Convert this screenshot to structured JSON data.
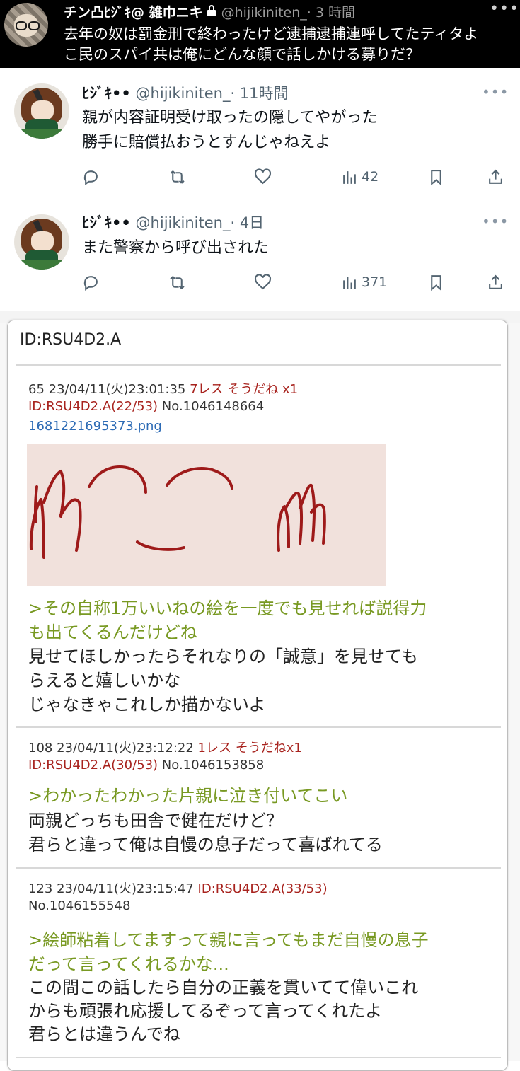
{
  "top_tweet": {
    "name": "チン凸ﾋｼﾞｷ@ 雑巾ニキ",
    "handle": "@hijikiniten_",
    "time": "· 3 時間",
    "more": "•••",
    "line1": "去年の奴は罰金刑で終わったけど逮捕逮捕連呼してたティタよ",
    "line2": "こ民のスパイ共は俺にどんな顔で話しかける募りだ？"
  },
  "tweets": [
    {
      "name": "ﾋｼﾞｷ••",
      "handle": "@hijikiniten_",
      "time": "· 11時間",
      "more": "•••",
      "line1": "親が内容証明受け取ったの隠してやがった",
      "line2": "勝手に賠償払おうとすんじゃねえよ",
      "views": "42"
    },
    {
      "name": "ﾋｼﾞｷ••",
      "handle": "@hijikiniten_",
      "time": "· 4日",
      "more": "•••",
      "line1": "また警察から呼び出された",
      "views": "371"
    }
  ],
  "popup": {
    "title": "ID:RSU4D2.A",
    "posts": [
      {
        "meta_plain": "65 23/04/11(火)23:01:35 ",
        "meta_red": "7レス そうだね x1",
        "id_red": "ID:RSU4D2.A(22/53)",
        "no": " No.1046148664",
        "file": "1681221695373.png",
        "quote1": ">その自称1万いいねの絵を一度でも見せれば説得力",
        "quote2": "も出てくるんだけどね",
        "text1": "見せてほしかったらそれなりの「誠意」を見せても",
        "text2": "らえると嬉しいかな",
        "text3": "じゃなきゃこれしか描かないよ"
      },
      {
        "meta_plain": "108 23/04/11(火)23:12:22 ",
        "meta_red": "1レス そうだねx1",
        "id_red": "ID:RSU4D2.A(30/53)",
        "no": " No.1046153858",
        "quote1": ">わかったわかった片親に泣き付いてこい",
        "text1": "両親どっちも田舎で健在だけど？",
        "text2": "君らと違って俺は自慢の息子だって喜ばれてる"
      },
      {
        "meta_plain": "123 23/04/11(火)23:15:47 ",
        "id_red": "ID:RSU4D2.A(33/53)",
        "no": "No.1046155548",
        "quote1": ">絵師粘着してますって親に言ってもまだ自慢の息子",
        "quote2": "だって言ってくれるかな...",
        "text1": "この間この話したら自分の正義を貫いてて偉いこれ",
        "text2": "からも頑張れ応援してるぞって言ってくれたよ",
        "text3": "君らとは違うんでね"
      }
    ]
  },
  "colors": {
    "quote_green": "#789922",
    "id_red": "#a8231e",
    "link_blue": "#2d6bb5",
    "icon_gray": "#536471"
  }
}
